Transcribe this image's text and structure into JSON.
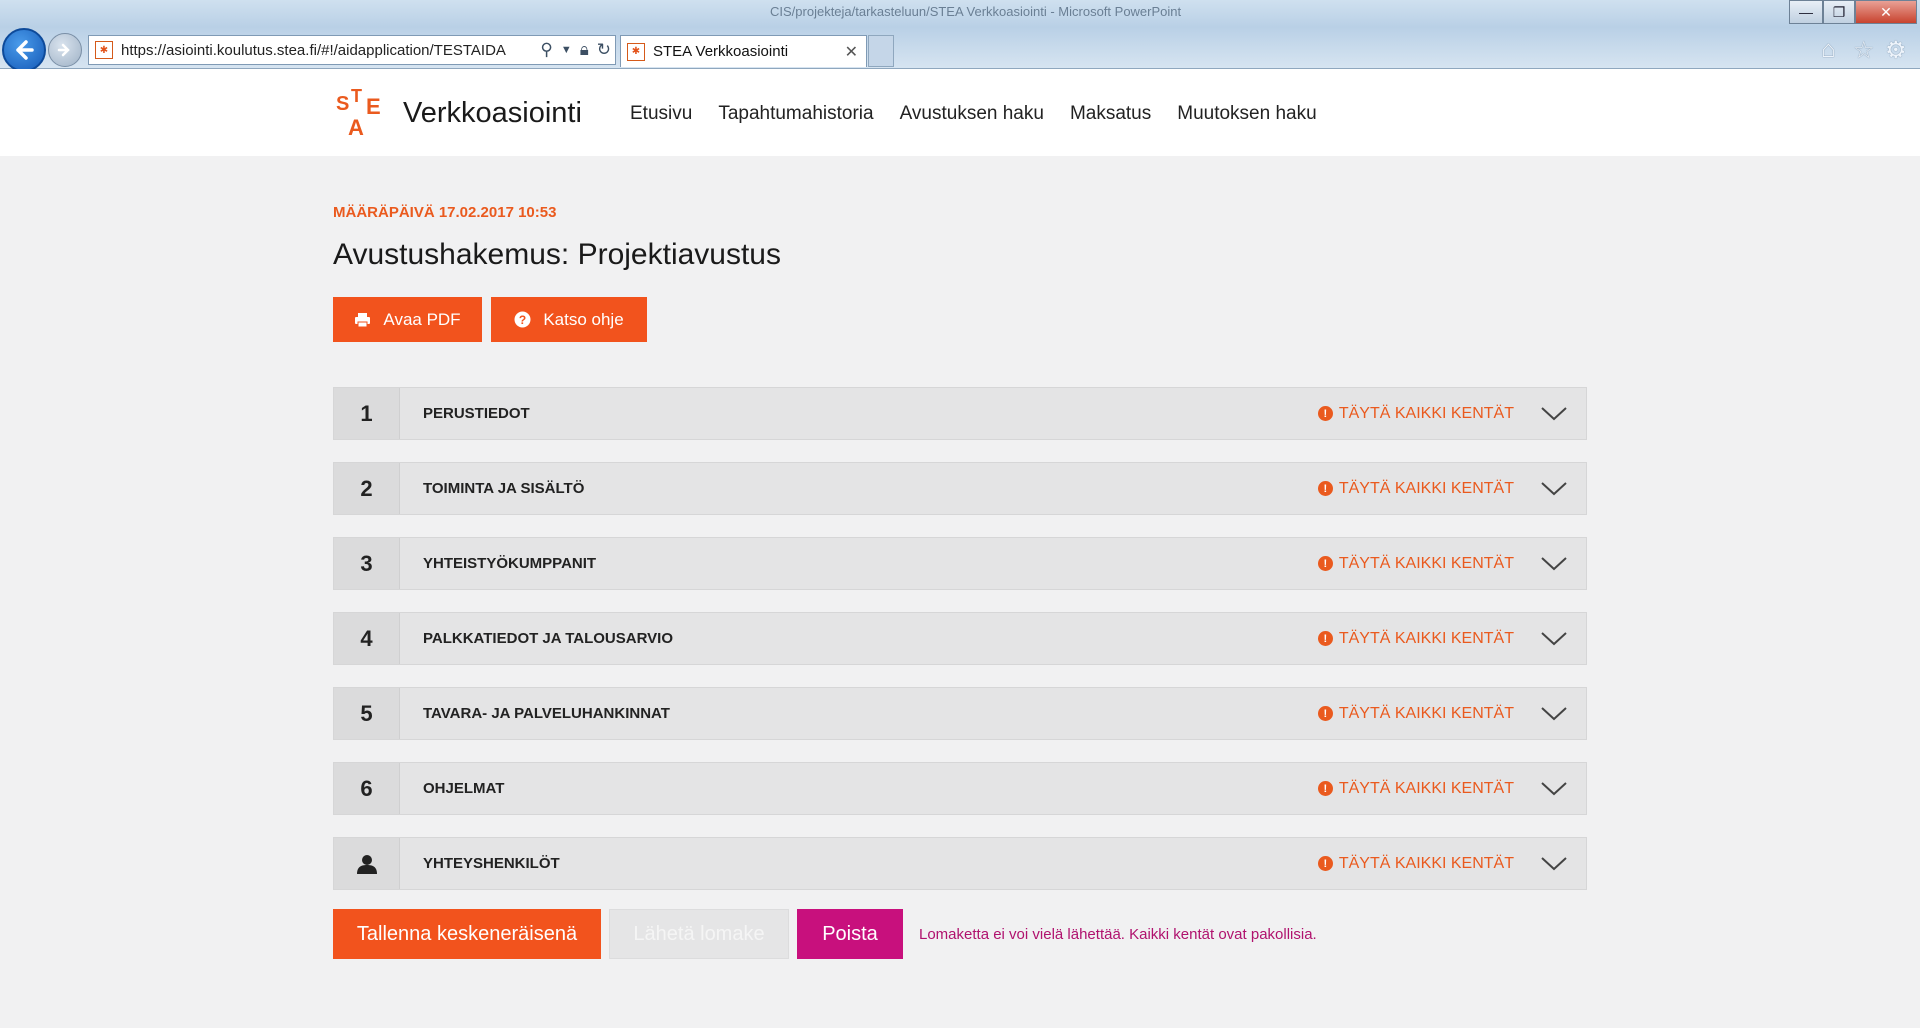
{
  "browser": {
    "window_title": "CIS/projekteja/tarkasteluun/STEA Verkkoasiointi - Microsoft PowerPoint",
    "url": "https://asiointi.koulutus.stea.fi/#!/aidapplication/TESTAIDA",
    "tab_title": "STEA Verkkoasiointi",
    "tab_close": "✕",
    "min": "—",
    "max": "❐",
    "close": "✕",
    "icons": [
      "back-icon",
      "forward-icon",
      "search-icon",
      "lock-icon",
      "refresh-icon",
      "home-icon",
      "star-icon",
      "gear-icon"
    ]
  },
  "site": {
    "title": "Verkkoasiointi",
    "nav": [
      "Etusivu",
      "Tapahtumahistoria",
      "Avustuksen haku",
      "Maksatus",
      "Muutoksen haku"
    ]
  },
  "main": {
    "deadline": "MÄÄRÄPÄIVÄ 17.02.2017 10:53",
    "title": "Avustushakemus: Projektiavustus",
    "pdf_button": "Avaa PDF",
    "help_button": "Katso ohje"
  },
  "sections": [
    {
      "num": "1",
      "title": "PERUSTIEDOT",
      "status": "TÄYTÄ KAIKKI KENTÄT"
    },
    {
      "num": "2",
      "title": "TOIMINTA JA SISÄLTÖ",
      "status": "TÄYTÄ KAIKKI KENTÄT"
    },
    {
      "num": "3",
      "title": "YHTEISTYÖKUMPPANIT",
      "status": "TÄYTÄ KAIKKI KENTÄT"
    },
    {
      "num": "4",
      "title": "PALKKATIEDOT JA TALOUSARVIO",
      "status": "TÄYTÄ KAIKKI KENTÄT"
    },
    {
      "num": "5",
      "title": "TAVARA- JA PALVELUHANKINNAT",
      "status": "TÄYTÄ KAIKKI KENTÄT"
    },
    {
      "num": "6",
      "title": "OHJELMAT",
      "status": "TÄYTÄ KAIKKI KENTÄT"
    },
    {
      "num": "",
      "title": "YHTEYSHENKILÖT",
      "status": "TÄYTÄ KAIKKI KENTÄT"
    }
  ],
  "actions": {
    "save": "Tallenna keskeneräisenä",
    "send": "Lähetä lomake",
    "delete": "Poista",
    "note": "Lomaketta ei voi vielä lähettää. Kaikki kentät ovat pakollisia."
  },
  "colors": {
    "accent": "#f2531d",
    "danger": "#c8107d",
    "status": "#ea5a1e"
  }
}
